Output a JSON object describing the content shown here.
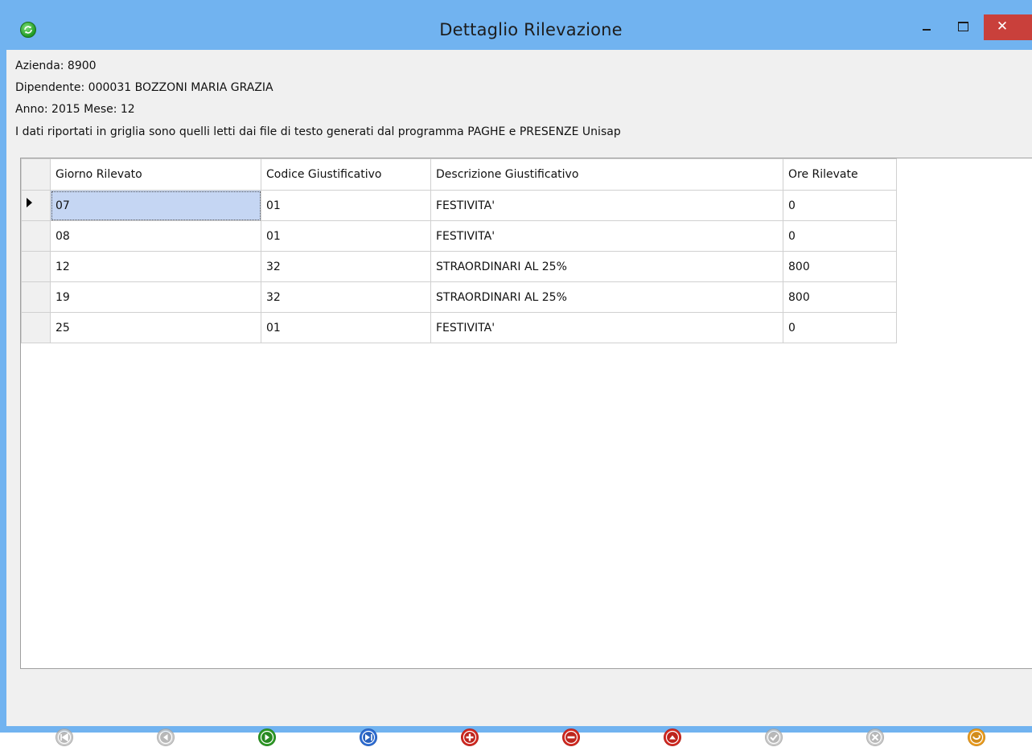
{
  "window": {
    "title": "Dettaglio Rilevazione"
  },
  "info": {
    "azienda": "Azienda: 8900",
    "dipendente": "Dipendente: 000031 BOZZONI MARIA GRAZIA",
    "periodo": "Anno: 2015 Mese: 12",
    "note": "I dati riportati in griglia sono quelli letti dai file di testo generati dal programma PAGHE e PRESENZE Unisap"
  },
  "grid": {
    "columns": [
      "Giorno Rilevato",
      "Codice Giustificativo",
      "Descrizione Giustificativo",
      "Ore Rilevate"
    ],
    "rows": [
      [
        "07",
        "01",
        "FESTIVITA'",
        "0"
      ],
      [
        "08",
        "01",
        "FESTIVITA'",
        "0"
      ],
      [
        "12",
        "32",
        "STRAORDINARI AL 25%",
        "800"
      ],
      [
        "19",
        "32",
        "STRAORDINARI AL 25%",
        "800"
      ],
      [
        "25",
        "01",
        "FESTIVITA'",
        "0"
      ]
    ],
    "current_row": 0
  },
  "navigator": {
    "buttons": [
      {
        "name": "first-record-icon",
        "color": "#c4c4c4",
        "enabled": false
      },
      {
        "name": "previous-record-icon",
        "color": "#c4c4c4",
        "enabled": false
      },
      {
        "name": "next-record-icon",
        "color": "#2e9c26",
        "enabled": true
      },
      {
        "name": "last-record-icon",
        "color": "#2f6fd8",
        "enabled": true
      },
      {
        "name": "insert-record-icon",
        "color": "#d62a22",
        "enabled": true
      },
      {
        "name": "delete-record-icon",
        "color": "#d62a22",
        "enabled": true
      },
      {
        "name": "edit-record-icon",
        "color": "#d62a22",
        "enabled": true
      },
      {
        "name": "post-edit-icon",
        "color": "#c4c4c4",
        "enabled": false
      },
      {
        "name": "cancel-edit-icon",
        "color": "#c4c4c4",
        "enabled": false
      },
      {
        "name": "refresh-icon",
        "color": "#f0a020",
        "enabled": true
      }
    ]
  }
}
